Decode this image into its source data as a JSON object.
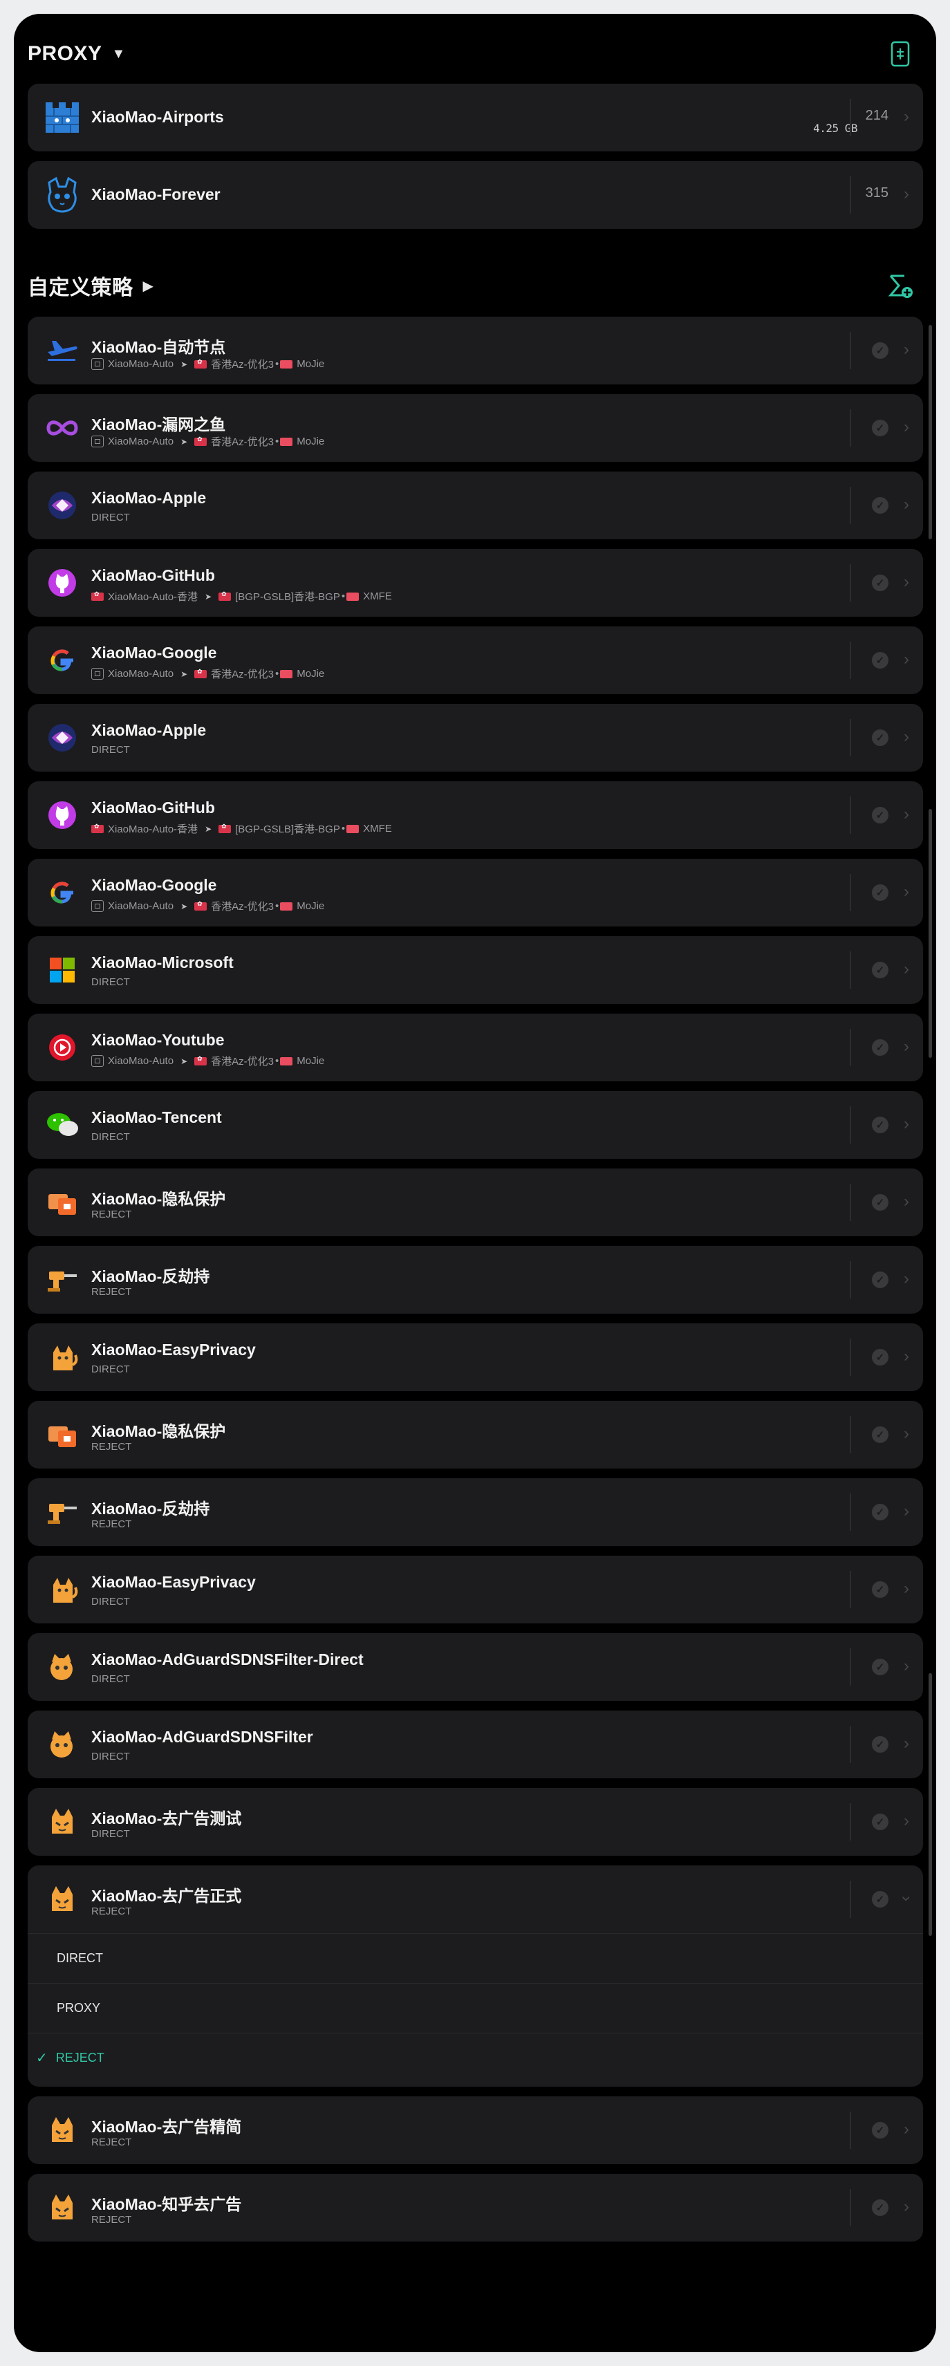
{
  "proxy_section": {
    "title": "PROXY",
    "items": [
      {
        "name": "XiaoMao-Airports",
        "count": "214",
        "traffic": "4.25 GB",
        "icon": "castle-wall-icon"
      },
      {
        "name": "XiaoMao-Forever",
        "count": "315",
        "icon": "raccoon-icon"
      }
    ]
  },
  "custom_section": {
    "title": "自定义策略",
    "items": [
      {
        "name": "XiaoMao-自动节点",
        "p1": "XiaoMao-Auto",
        "p2": "香港Az-优化3",
        "p3": "MoJie"
      },
      {
        "name": "XiaoMao-漏网之鱼",
        "p1": "XiaoMao-Auto",
        "p2": "香港Az-优化3",
        "p3": "MoJie"
      },
      {
        "name": "XiaoMao-Apple",
        "policy": "DIRECT"
      },
      {
        "name": "XiaoMao-GitHub",
        "p1": "XiaoMao-Auto-香港",
        "p2": "[BGP-GSLB]香港-BGP",
        "p3": "XMFE"
      },
      {
        "name": "XiaoMao-Google",
        "p1": "XiaoMao-Auto",
        "p2": "香港Az-优化3",
        "p3": "MoJie"
      },
      {
        "name": "XiaoMao-Apple",
        "policy": "DIRECT"
      },
      {
        "name": "XiaoMao-GitHub",
        "p1": "XiaoMao-Auto-香港",
        "p2": "[BGP-GSLB]香港-BGP",
        "p3": "XMFE"
      },
      {
        "name": "XiaoMao-Google",
        "p1": "XiaoMao-Auto",
        "p2": "香港Az-优化3",
        "p3": "MoJie"
      },
      {
        "name": "XiaoMao-Microsoft",
        "policy": "DIRECT"
      },
      {
        "name": "XiaoMao-Youtube",
        "p1": "XiaoMao-Auto",
        "p2": "香港Az-优化3",
        "p3": "MoJie"
      },
      {
        "name": "XiaoMao-Tencent",
        "policy": "DIRECT"
      },
      {
        "name": "XiaoMao-隐私保护",
        "policy": "REJECT"
      },
      {
        "name": "XiaoMao-反劫持",
        "policy": "REJECT"
      },
      {
        "name": "XiaoMao-EasyPrivacy",
        "policy": "DIRECT"
      },
      {
        "name": "XiaoMao-隐私保护",
        "policy": "REJECT"
      },
      {
        "name": "XiaoMao-反劫持",
        "policy": "REJECT"
      },
      {
        "name": "XiaoMao-EasyPrivacy",
        "policy": "DIRECT"
      },
      {
        "name": "XiaoMao-AdGuardSDNSFilter-Direct",
        "policy": "DIRECT"
      },
      {
        "name": "XiaoMao-AdGuardSDNSFilter",
        "policy": "DIRECT"
      },
      {
        "name": "XiaoMao-去广告测试",
        "policy": "DIRECT"
      },
      {
        "name": "XiaoMao-去广告正式",
        "policy": "REJECT"
      },
      {
        "name": "XiaoMao-去广告精简",
        "policy": "REJECT"
      },
      {
        "name": "XiaoMao-知乎去广告",
        "policy": "REJECT"
      }
    ],
    "expanded_options": [
      "DIRECT",
      "PROXY",
      "REJECT"
    ],
    "selected_option": "REJECT"
  },
  "colors": {
    "accent": "#30c7a5",
    "card": "#1c1c1e",
    "background": "#000000"
  }
}
